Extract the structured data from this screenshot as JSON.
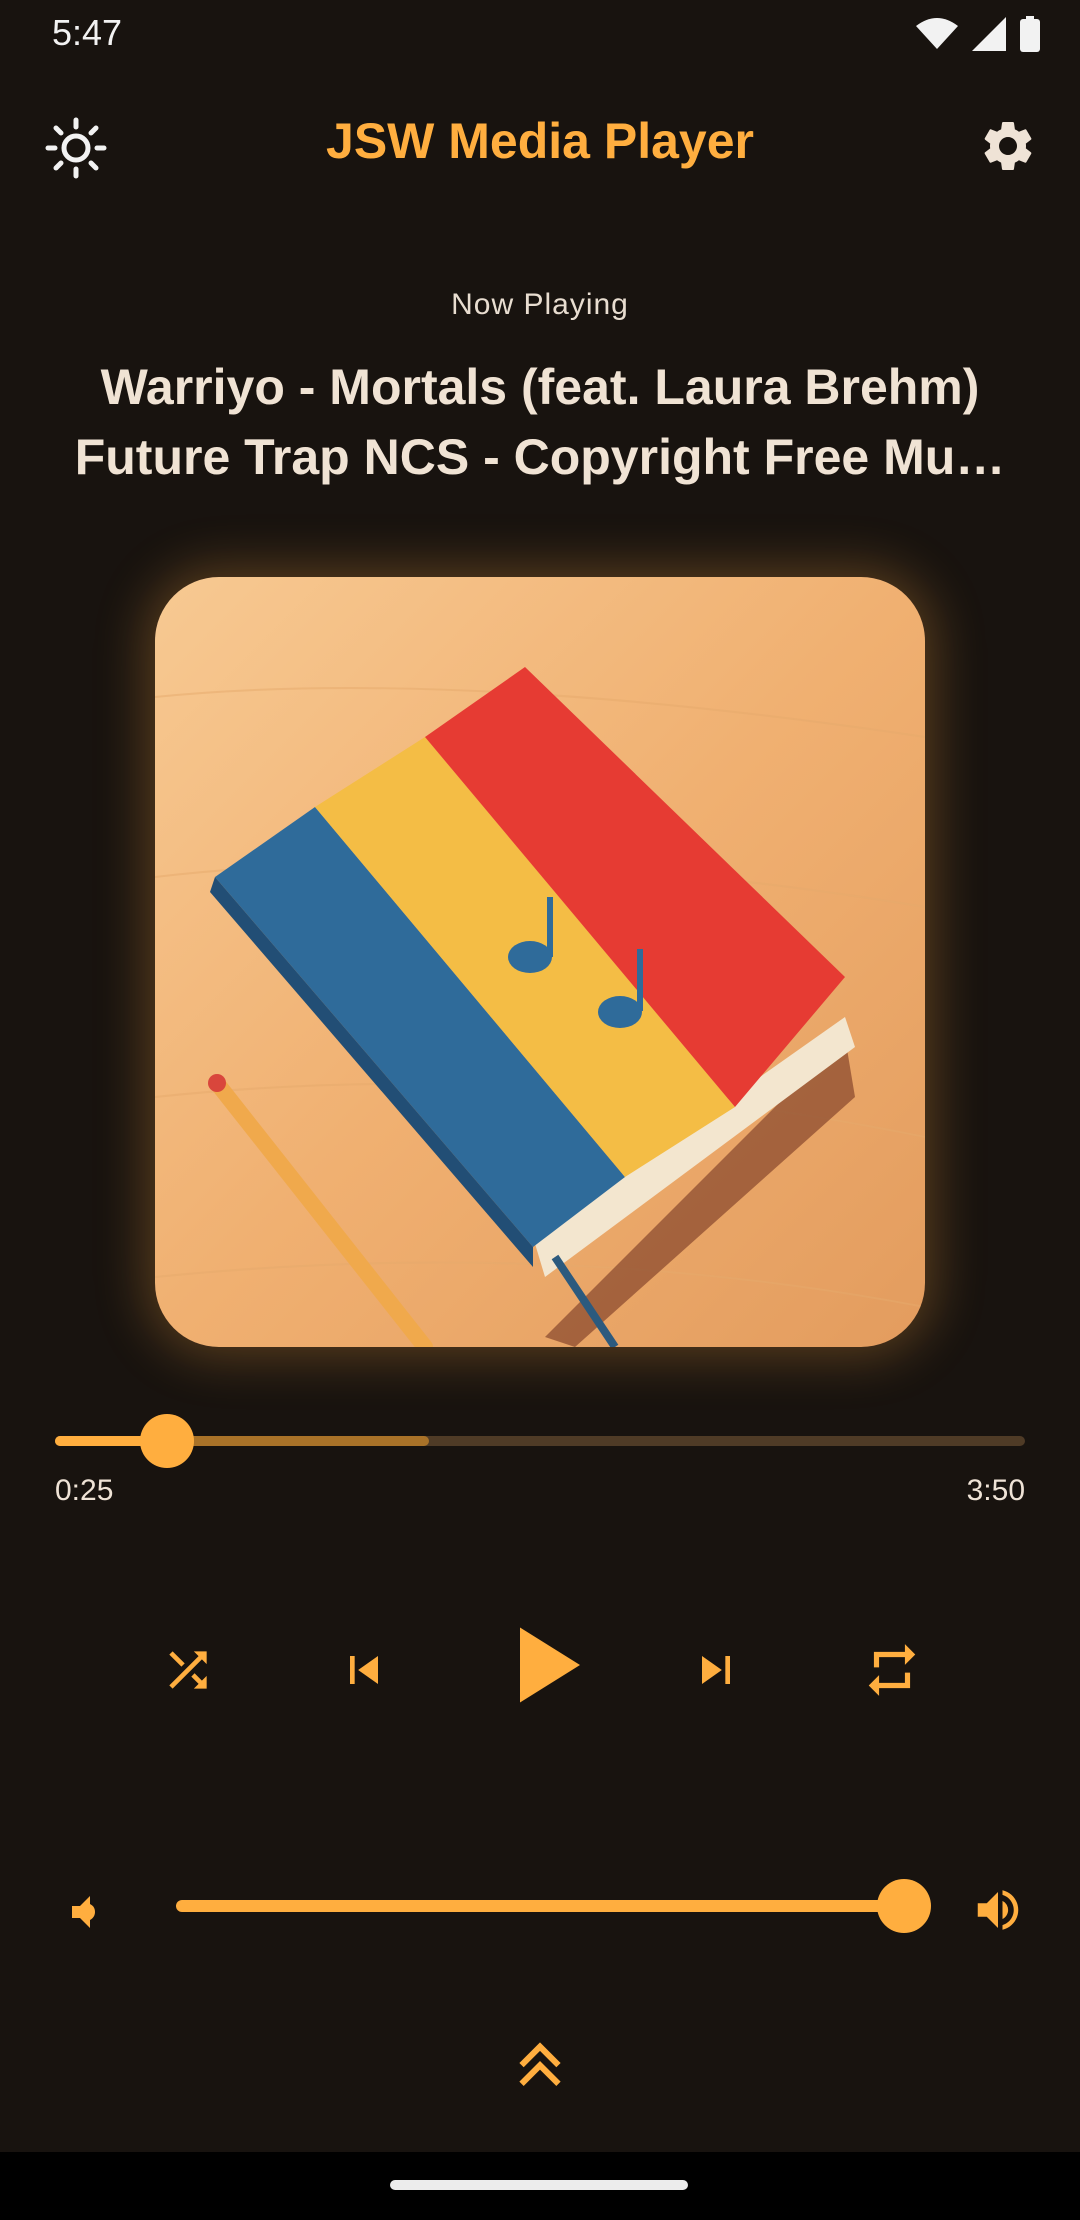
{
  "status_bar": {
    "time": "5:47",
    "icons": [
      "wifi-icon",
      "cell-signal-icon",
      "battery-icon"
    ]
  },
  "app_bar": {
    "title": "JSW Media Player",
    "left_icon": "sun-icon",
    "right_icon": "gear-icon"
  },
  "now_playing": {
    "label": "Now Playing",
    "title_line1": "Warriyo - Mortals (feat. Laura Brehm)",
    "title_line2": "Future Trap  NCS - Copyright Free Mu…"
  },
  "artwork": {
    "description_icon": "album-art"
  },
  "playback": {
    "elapsed": "0:25",
    "duration": "3:50",
    "progress_fraction": 0.115,
    "buffered_fraction": 0.386
  },
  "controls": {
    "shuffle_icon": "shuffle-icon",
    "previous_icon": "skip-previous-icon",
    "play_icon": "play-icon",
    "next_icon": "skip-next-icon",
    "repeat_icon": "repeat-icon"
  },
  "volume": {
    "level_fraction": 1.0,
    "low_icon": "volume-low-icon",
    "high_icon": "volume-high-icon"
  },
  "bottom": {
    "expand_icon": "double-chevron-up-icon"
  },
  "colors": {
    "accent": "#ffae3f",
    "background": "#18130f",
    "text": "#efe3d6"
  }
}
